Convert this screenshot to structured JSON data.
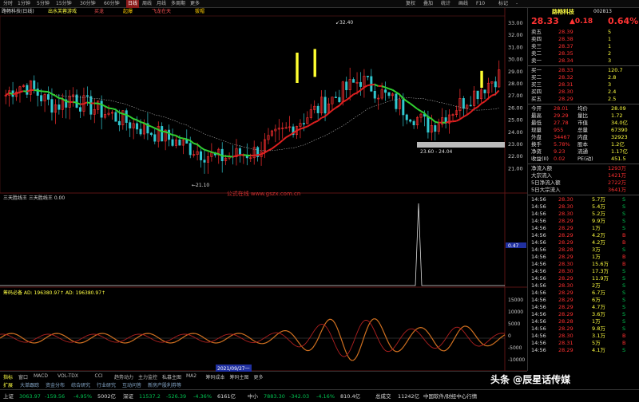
{
  "topbar": {
    "tabs": [
      "分时",
      "1分钟",
      "5分钟",
      "15分钟",
      "30分钟",
      "60分钟",
      "日线",
      "周线",
      "月线",
      "多周期",
      "更多"
    ],
    "active": "日线",
    "right_tabs": [
      "复权",
      "叠加",
      "统计",
      "画线",
      "F10",
      "标记",
      "-"
    ]
  },
  "indicators_header": {
    "stock": "路畅科技(日线)",
    "items": [
      "出水芙蓉游戏",
      "买龙",
      "起爆",
      "飞龙在天",
      "拔帽"
    ]
  },
  "price_axis": [
    "33.00",
    "32.00",
    "31.00",
    "30.00",
    "29.00",
    "28.00",
    "27.00",
    "26.00",
    "25.00",
    "24.00",
    "23.00",
    "22.00",
    "21.00"
  ],
  "price_annotations": {
    "high": "32.40",
    "low": "21.10",
    "range_box": "23.60 - 24.04"
  },
  "panel2": {
    "title": "三天胜线王  三天胜线王  0.00",
    "watermark": "公式在线  www.gszx.com.cn",
    "axis": [
      "0.47",
      "0.00"
    ],
    "tag": "0.47"
  },
  "panel3": {
    "title": "筹码必备  AD: 196380.97↑  AD: 196380.97↑",
    "axis": [
      "15000",
      "10000",
      "5000",
      "0",
      "-5000",
      "-10000"
    ]
  },
  "bottom_tabs": {
    "row1": [
      "指标",
      "窗口",
      "MACD",
      "VOL-TDX",
      "CCI",
      "趋势动力",
      "主力监控",
      "私募主图",
      "MA2",
      "筹码成本",
      "筹码主图",
      "更多"
    ],
    "row2": [
      "扩展",
      "大单跟踪",
      "资金分布",
      "综合研究",
      "行业研究",
      "互动问答",
      "新房产股利券等"
    ],
    "date_marker": "2021/09/27一"
  },
  "panel": {
    "name": "路畅科技",
    "code": "002813",
    "price": "28.33",
    "change": "▲0.18",
    "pct": "0.64%",
    "asks": [
      {
        "label": "卖五",
        "price": "28.39",
        "vol": "5"
      },
      {
        "label": "卖四",
        "price": "28.38",
        "vol": "1"
      },
      {
        "label": "卖三",
        "price": "28.37",
        "vol": "1"
      },
      {
        "label": "卖二",
        "price": "28.35",
        "vol": "2"
      },
      {
        "label": "卖一",
        "price": "28.34",
        "vol": "3"
      }
    ],
    "bids": [
      {
        "label": "买一",
        "price": "28.33",
        "vol": "120.7"
      },
      {
        "label": "买二",
        "price": "28.32",
        "vol": "2.8"
      },
      {
        "label": "买三",
        "price": "28.31",
        "vol": "3"
      },
      {
        "label": "买四",
        "price": "28.30",
        "vol": "2.4"
      },
      {
        "label": "买五",
        "price": "28.29",
        "vol": "2.5"
      }
    ],
    "stats": [
      {
        "l": "今开",
        "v": "28.01",
        "l2": "均价",
        "v2": "28.09"
      },
      {
        "l": "最高",
        "v": "29.29",
        "l2": "量比",
        "v2": "1.72"
      },
      {
        "l": "最低",
        "v": "27.78",
        "l2": "市值",
        "v2": "34.0亿"
      },
      {
        "l": "现量",
        "v": "955",
        "l2": "总量",
        "v2": "67390"
      },
      {
        "l": "外盘",
        "v": "34467",
        "l2": "内盘",
        "v2": "32923"
      },
      {
        "l": "换手",
        "v": "5.78%",
        "l2": "股本",
        "v2": "1.2亿"
      },
      {
        "l": "净资",
        "v": "9.23",
        "l2": "流通",
        "v2": "1.17亿"
      },
      {
        "l": "收益(II)",
        "v": "0.02",
        "l2": "PE(动)",
        "v2": "451.5"
      }
    ],
    "flows": [
      {
        "l": "净流入额",
        "v": "1293万"
      },
      {
        "l": "大宗流入",
        "v": "1421万"
      },
      {
        "l": "5日净流入额",
        "v": "2722万"
      },
      {
        "l": "5日大宗流入",
        "v": "3641万"
      }
    ],
    "ticks": [
      {
        "t": "14:56",
        "p": "28.30",
        "v": "5.7万",
        "d": "S"
      },
      {
        "t": "14:56",
        "p": "28.30",
        "v": "5.4万",
        "d": "S"
      },
      {
        "t": "14:56",
        "p": "28.30",
        "v": "5.2万",
        "d": "S"
      },
      {
        "t": "14:56",
        "p": "28.29",
        "v": "9.9万",
        "d": "S"
      },
      {
        "t": "14:56",
        "p": "28.29",
        "v": "1万",
        "d": "S"
      },
      {
        "t": "14:56",
        "p": "28.29",
        "v": "4.2万",
        "d": "B"
      },
      {
        "t": "14:56",
        "p": "28.29",
        "v": "4.2万",
        "d": "B"
      },
      {
        "t": "14:56",
        "p": "28.28",
        "v": "3万",
        "d": "S"
      },
      {
        "t": "14:56",
        "p": "28.29",
        "v": "1万",
        "d": "B"
      },
      {
        "t": "14:56",
        "p": "28.30",
        "v": "15.6万",
        "d": "B"
      },
      {
        "t": "14:56",
        "p": "28.30",
        "v": "17.3万",
        "d": "S"
      },
      {
        "t": "14:56",
        "p": "28.29",
        "v": "11.9万",
        "d": "S"
      },
      {
        "t": "14:56",
        "p": "28.30",
        "v": "2万",
        "d": "S"
      },
      {
        "t": "14:56",
        "p": "28.29",
        "v": "6.7万",
        "d": "S"
      },
      {
        "t": "14:56",
        "p": "28.29",
        "v": "6万",
        "d": "S"
      },
      {
        "t": "14:56",
        "p": "28.29",
        "v": "4.7万",
        "d": "S"
      },
      {
        "t": "14:56",
        "p": "28.29",
        "v": "3.6万",
        "d": "S"
      },
      {
        "t": "14:56",
        "p": "28.28",
        "v": "1万",
        "d": "S"
      },
      {
        "t": "14:56",
        "p": "28.29",
        "v": "9.8万",
        "d": "S"
      },
      {
        "t": "14:56",
        "p": "28.30",
        "v": "3.1万",
        "d": "B"
      },
      {
        "t": "14:56",
        "p": "28.31",
        "v": "5万",
        "d": "B"
      },
      {
        "t": "14:56",
        "p": "28.29",
        "v": "4.1万",
        "d": "S"
      }
    ]
  },
  "bottombar": {
    "sh_label": "上证",
    "sh": "3063.97",
    "sh_chg": "-159.56",
    "sh_pct": "-4.95%",
    "sh_amt": "5002亿",
    "sz_label": "深证",
    "sz": "11537.2",
    "sz_chg": "-526.39",
    "sz_pct": "-4.36%",
    "sz_amt": "6161亿",
    "zx_label": "中小",
    "zx": "7883.30",
    "zx_chg": "-342.03",
    "zx_pct": "-4.16%",
    "zx_amt": "810.4亿",
    "total_label": "总成交",
    "total": "11242亿",
    "ticker": "中国软件/财经中心行情"
  },
  "watermark": "头条 @辰星话传媒",
  "colors": {
    "up": "#ff3030",
    "down": "#00c0c0",
    "ma_green": "#30d030",
    "ma_red": "#e02020"
  }
}
